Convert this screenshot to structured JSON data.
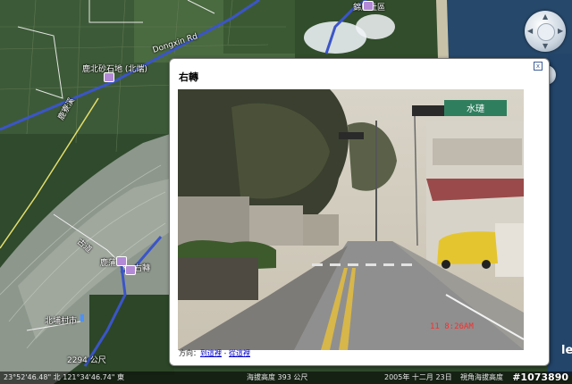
{
  "map": {
    "labels": [
      "鹿北砂石地 (北端)",
      "Dongxin Rd",
      "鹿寮溪",
      "錦屏社區",
      "古道",
      "右轉",
      "北埔村市",
      "2294 公尺",
      "鹿蒲岸"
    ]
  },
  "balloon": {
    "title": "右轉",
    "close_label": "x",
    "photo": {
      "timestamp": "11  8:26AM",
      "sign_text": "水璉"
    },
    "directions": {
      "prefix": "方向：",
      "to_here": "到這裡",
      "separator": " - ",
      "from_here": "從這裡"
    }
  },
  "status": {
    "coords": "23°52'46.48\" 北  121°34'46.74\" 東",
    "elevation": "海拔高度  393 公尺",
    "date": "2005年 十二月 23日",
    "eye_alt": "視角海拔高度"
  },
  "watermark": "#1073890",
  "brand_fragment": "le",
  "icons": [
    "navigation-compass-icon",
    "zoom-control-icon",
    "placemark-icon",
    "close-icon"
  ]
}
